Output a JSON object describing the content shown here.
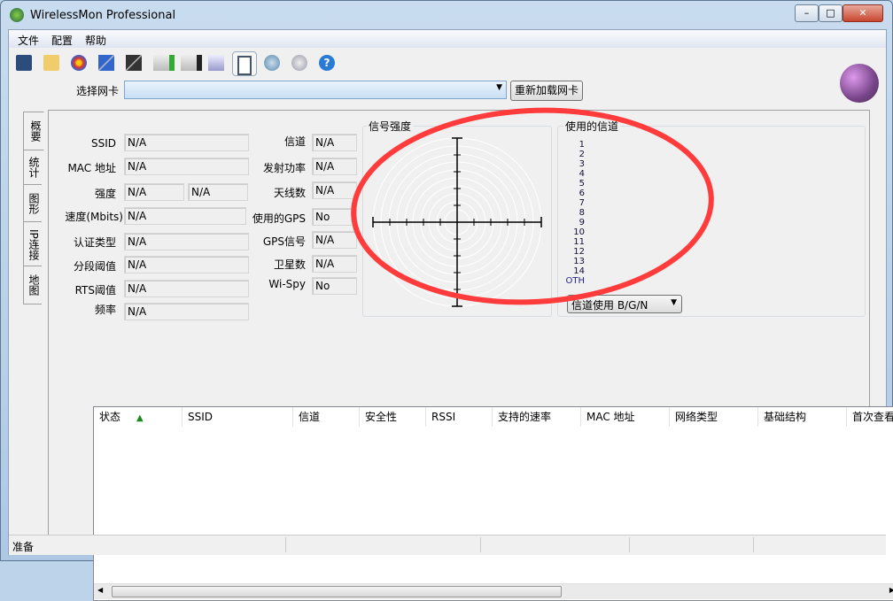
{
  "window": {
    "title": "WirelessMon Professional",
    "min": "–",
    "max": "□",
    "close": "✕"
  },
  "menu": [
    "文件",
    "配置",
    "帮助"
  ],
  "toolbar": [
    "save-icon",
    "open-folder-icon",
    "target-icon",
    "connect-icon",
    "disconnect-icon",
    "log-start-icon",
    "log-stop-icon",
    "log-verify-icon",
    "clipboard-icon",
    "globe-check-icon",
    "info-bubble-icon",
    "help-icon"
  ],
  "adapter": {
    "label": "选择网卡",
    "value": "",
    "reload": "重新加载网卡"
  },
  "tabs": [
    "概要",
    "统计",
    "图形",
    "IP连接",
    "地图"
  ],
  "fields_left": [
    {
      "label": "SSID",
      "value": "N/A"
    },
    {
      "label": "MAC 地址",
      "value": "N/A"
    },
    {
      "label": "强度",
      "value": "N/A",
      "value2": "N/A"
    },
    {
      "label": "速度(Mbits)",
      "value": "N/A"
    },
    {
      "label": "认证类型",
      "value": "N/A"
    },
    {
      "label": "分段阈值",
      "value": "N/A"
    },
    {
      "label": "RTS阈值",
      "value": "N/A"
    },
    {
      "label": "频率",
      "value": "N/A"
    }
  ],
  "fields_right": [
    {
      "label": "信道",
      "value": "N/A"
    },
    {
      "label": "发射功率",
      "value": "N/A"
    },
    {
      "label": "天线数",
      "value": "N/A"
    },
    {
      "label": "使用的GPS",
      "value": "No"
    },
    {
      "label": "GPS信号",
      "value": "N/A"
    },
    {
      "label": "卫星数",
      "value": "N/A"
    },
    {
      "label": "Wi-Spy",
      "value": "No"
    }
  ],
  "signal": {
    "title": "信号强度"
  },
  "channels": {
    "title": "使用的信道",
    "list": [
      "1",
      "2",
      "3",
      "4",
      "5",
      "6",
      "7",
      "8",
      "9",
      "10",
      "11",
      "12",
      "13",
      "14",
      "OTH"
    ],
    "mode": "信道使用 B/G/N"
  },
  "table": {
    "columns": [
      "状态",
      "SSID",
      "信道",
      "安全性",
      "RSSI",
      "支持的速率",
      "MAC 地址",
      "网络类型",
      "基础结构",
      "首次查看"
    ],
    "sort": "▲",
    "rows": []
  },
  "status": {
    "text": "准备"
  },
  "colors": {
    "annotation": "#ff3b3b"
  }
}
